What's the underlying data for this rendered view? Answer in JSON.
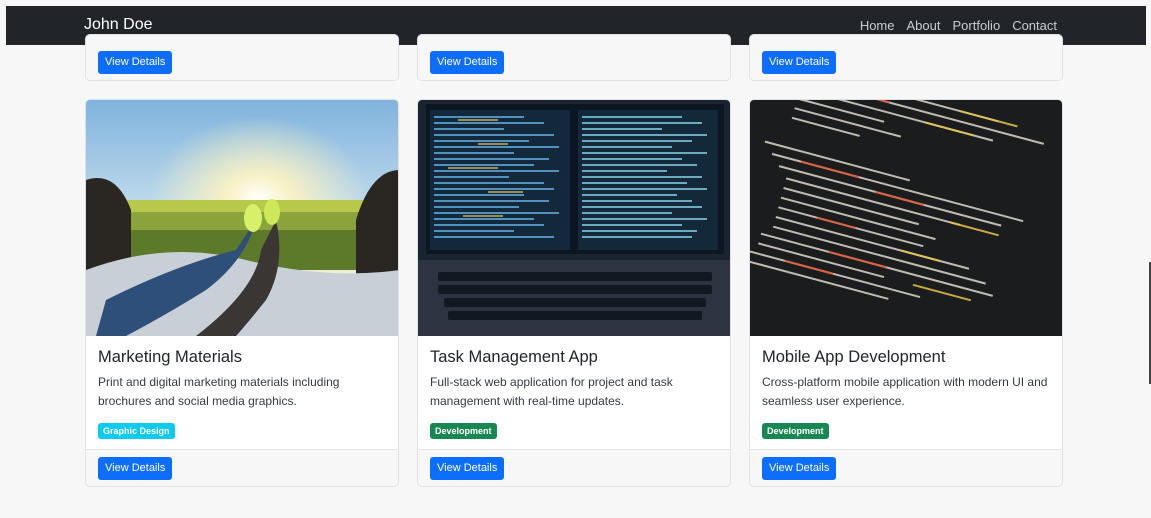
{
  "navbar": {
    "brand": "John Doe",
    "links": [
      "Home",
      "About",
      "Portfolio",
      "Contact"
    ]
  },
  "top_cards": [
    {
      "button": "View Details"
    },
    {
      "button": "View Details"
    },
    {
      "button": "View Details"
    }
  ],
  "cards": [
    {
      "image": "sunset-field-photo",
      "title": "Marketing Materials",
      "description": "Print and digital marketing materials including brochures and social media graphics.",
      "badge": "Graphic Design",
      "badge_color": "#0dcaf0",
      "button": "View Details"
    },
    {
      "image": "laptop-code-photo",
      "title": "Task Management App",
      "description": "Full-stack web application for project and task management with real-time updates.",
      "badge": "Development",
      "badge_color": "#198754",
      "button": "View Details"
    },
    {
      "image": "code-screen-photo",
      "title": "Mobile App Development",
      "description": "Cross-platform mobile application with modern UI and seamless user experience.",
      "badge": "Development",
      "badge_color": "#198754",
      "button": "View Details"
    }
  ],
  "colors": {
    "navbar_bg": "#212529",
    "primary_button": "#0d6efd"
  }
}
